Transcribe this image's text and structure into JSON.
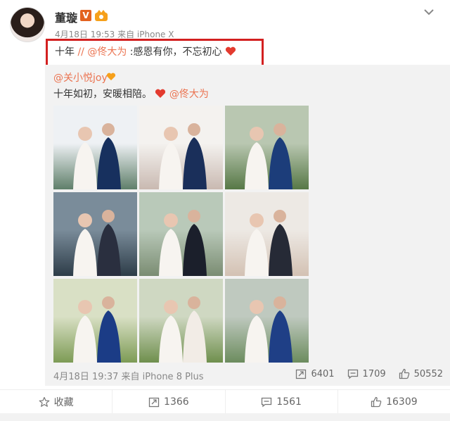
{
  "post": {
    "user_name": "董璇",
    "vip_badge": "V",
    "timestamp_source": "4月18日 19:53 来自 iPhone X",
    "content_prefix": "十年",
    "content_sep": "//",
    "mention": "@佟大为",
    "content_suffix": ":感恩有你，不忘初心"
  },
  "repost": {
    "original_user": "@关小悦joy",
    "original_text_prefix": "十年如初，安暖相陪。",
    "original_mention": "@佟大为",
    "photos": [
      {
        "bg1": "#eef1f4",
        "bg2": "#5f7f6a",
        "fig": "#17305e"
      },
      {
        "bg1": "#f4f2ef",
        "bg2": "#c9b9b1",
        "fig": "#1a2f5a"
      },
      {
        "bg1": "#b9c7b1",
        "bg2": "#577846",
        "fig": "#1c3d7a"
      },
      {
        "bg1": "#7a8c9a",
        "bg2": "#2d3c48",
        "fig": "#2a2f3f"
      },
      {
        "bg1": "#b9c9b9",
        "bg2": "#7a8c72",
        "fig": "#1b1f2b"
      },
      {
        "bg1": "#ede9e4",
        "bg2": "#d3c1b3",
        "fig": "#262a36"
      },
      {
        "bg1": "#d9e0c5",
        "bg2": "#7d9b55",
        "fig": "#1b3c86"
      },
      {
        "bg1": "#cfd8c2",
        "bg2": "#6f8f4d",
        "fig": "#f2ece6"
      },
      {
        "bg1": "#bfc9bf",
        "bg2": "#6c8c5e",
        "fig": "#1f3f86"
      }
    ],
    "meta": "4月18日 19:37 来自 iPhone 8 Plus",
    "stats": {
      "repost": "6401",
      "comment": "1709",
      "like": "50552"
    }
  },
  "actions": {
    "favorite": "收藏",
    "repost": "1366",
    "comment": "1561",
    "like": "16309"
  },
  "colors": {
    "accent": "#eb7350",
    "highlight_box": "#d32020",
    "heart": "#e33b2f"
  }
}
